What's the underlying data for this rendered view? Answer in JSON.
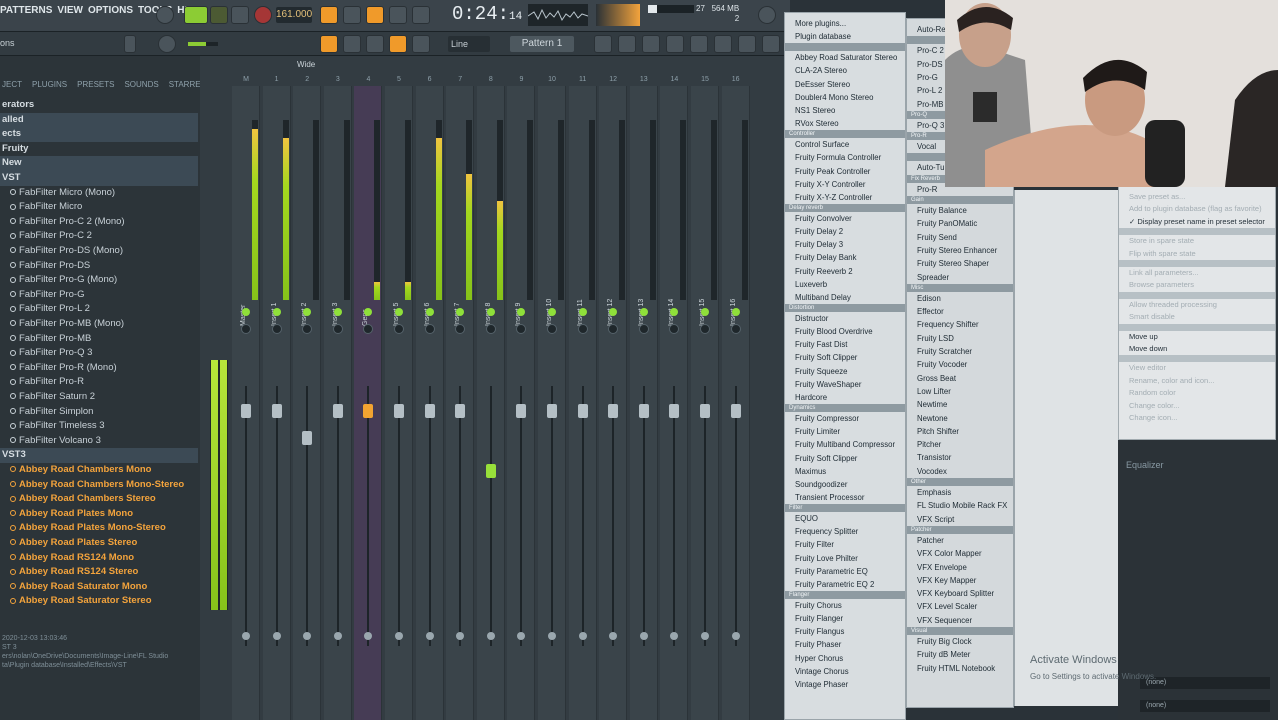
{
  "menu": [
    "PATTERNS",
    "VIEW",
    "OPTIONS",
    "TOOLS",
    "HELP"
  ],
  "transport": {
    "tempo": "161.000",
    "time_main": "0:24:",
    "time_sub": "14",
    "cpu_a": "27",
    "mem": "564 MB",
    "poly": "2"
  },
  "toolbar": {
    "snap": "Line",
    "pattern": "Pattern 1"
  },
  "browser": {
    "header_left": "ons",
    "tabs": [
      "JECT",
      "PLUGINS",
      "PRESETS",
      "SOUNDS",
      "STARRED"
    ],
    "items": [
      {
        "label": "erators",
        "kind": "folder"
      },
      {
        "label": "alled",
        "kind": "folder",
        "sel": true
      },
      {
        "label": "ects",
        "kind": "folder",
        "sel": true
      },
      {
        "label": "Fruity",
        "kind": "folder"
      },
      {
        "label": "New",
        "kind": "folder",
        "sel": true
      },
      {
        "label": "VST",
        "kind": "folder",
        "sel": true
      },
      {
        "label": "FabFilter Micro (Mono)",
        "kind": "plugin"
      },
      {
        "label": "FabFilter Micro",
        "kind": "plugin"
      },
      {
        "label": "FabFilter Pro-C 2 (Mono)",
        "kind": "plugin"
      },
      {
        "label": "FabFilter Pro-C 2",
        "kind": "plugin"
      },
      {
        "label": "FabFilter Pro-DS (Mono)",
        "kind": "plugin"
      },
      {
        "label": "FabFilter Pro-DS",
        "kind": "plugin"
      },
      {
        "label": "FabFilter Pro-G (Mono)",
        "kind": "plugin"
      },
      {
        "label": "FabFilter Pro-G",
        "kind": "plugin"
      },
      {
        "label": "FabFilter Pro-L 2",
        "kind": "plugin"
      },
      {
        "label": "FabFilter Pro-MB (Mono)",
        "kind": "plugin"
      },
      {
        "label": "FabFilter Pro-MB",
        "kind": "plugin"
      },
      {
        "label": "FabFilter Pro-Q 3",
        "kind": "plugin"
      },
      {
        "label": "FabFilter Pro-R (Mono)",
        "kind": "plugin"
      },
      {
        "label": "FabFilter Pro-R",
        "kind": "plugin"
      },
      {
        "label": "FabFilter Saturn 2",
        "kind": "plugin"
      },
      {
        "label": "FabFilter Simplon",
        "kind": "plugin"
      },
      {
        "label": "FabFilter Timeless 3",
        "kind": "plugin"
      },
      {
        "label": "FabFilter Volcano 3",
        "kind": "plugin"
      },
      {
        "label": "VST3",
        "kind": "folder",
        "sel": true
      },
      {
        "label": "Abbey Road Chambers Mono",
        "kind": "plugin",
        "orange": true
      },
      {
        "label": "Abbey Road Chambers Mono-Stereo",
        "kind": "plugin",
        "orange": true
      },
      {
        "label": "Abbey Road Chambers Stereo",
        "kind": "plugin",
        "orange": true
      },
      {
        "label": "Abbey Road Plates Mono",
        "kind": "plugin",
        "orange": true
      },
      {
        "label": "Abbey Road Plates Mono-Stereo",
        "kind": "plugin",
        "orange": true
      },
      {
        "label": "Abbey Road Plates Stereo",
        "kind": "plugin",
        "orange": true
      },
      {
        "label": "Abbey Road RS124 Mono",
        "kind": "plugin",
        "orange": true
      },
      {
        "label": "Abbey Road RS124 Stereo",
        "kind": "plugin",
        "orange": true
      },
      {
        "label": "Abbey Road Saturator Mono",
        "kind": "plugin",
        "orange": true
      },
      {
        "label": "Abbey Road Saturator Stereo",
        "kind": "plugin",
        "orange": true
      }
    ],
    "info": [
      "2020-12-03 13:03:46",
      "ST 3",
      "ers\\nolan\\OneDrive\\Documents\\Image-Line\\FL Studio",
      "ta\\Plugin database\\Installed\\Effects\\VST"
    ]
  },
  "mixer": {
    "view_mode": "Wide",
    "strips": [
      {
        "num": "M",
        "label": "Master",
        "meter": 0.95,
        "knob": true
      },
      {
        "num": "1",
        "label": "Insert 1",
        "meter": 0.9,
        "knob": true
      },
      {
        "num": "2",
        "label": "Insert 2",
        "meter": 0,
        "knob": true
      },
      {
        "num": "3",
        "label": "Insert 3",
        "meter": 0,
        "knob": true
      },
      {
        "num": "4",
        "label": "Gens",
        "meter": 0.1,
        "knob": true,
        "sel": true
      },
      {
        "num": "5",
        "label": "Insert 5",
        "meter": 0.1,
        "knob": true
      },
      {
        "num": "6",
        "label": "Insert 6",
        "meter": 0.9,
        "knob": true
      },
      {
        "num": "7",
        "label": "Insert 7",
        "meter": 0.7,
        "knob": true
      },
      {
        "num": "8",
        "label": "Insert 8",
        "meter": 0.55,
        "knob": true
      },
      {
        "num": "9",
        "label": "Insert 9",
        "meter": 0,
        "knob": true
      },
      {
        "num": "10",
        "label": "Insert 10",
        "meter": 0,
        "knob": true
      },
      {
        "num": "11",
        "label": "Insert 11",
        "meter": 0,
        "knob": true
      },
      {
        "num": "12",
        "label": "Insert 12",
        "meter": 0,
        "knob": true
      },
      {
        "num": "13",
        "label": "Insert 13",
        "meter": 0,
        "knob": true
      },
      {
        "num": "14",
        "label": "Insert 14",
        "meter": 0,
        "knob": true
      },
      {
        "num": "15",
        "label": "Insert 15",
        "meter": 0,
        "knob": true
      },
      {
        "num": "16",
        "label": "Insert 16",
        "meter": 0,
        "knob": true
      }
    ]
  },
  "menu1": [
    {
      "t": "More plugins..."
    },
    {
      "t": "Plugin database"
    },
    {
      "h": true
    },
    {
      "t": "Abbey Road Saturator Stereo"
    },
    {
      "t": "CLA-2A Stereo"
    },
    {
      "t": "DeEsser Stereo"
    },
    {
      "t": "Doubler4 Mono Stereo"
    },
    {
      "t": "NS1 Stereo"
    },
    {
      "t": "RVox Stereo"
    },
    {
      "h": true,
      "t": "Controller"
    },
    {
      "t": "Control Surface"
    },
    {
      "t": "Fruity Formula Controller"
    },
    {
      "t": "Fruity Peak Controller"
    },
    {
      "t": "Fruity X-Y Controller"
    },
    {
      "t": "Fruity X-Y-Z Controller"
    },
    {
      "h": true,
      "t": "Delay reverb"
    },
    {
      "t": "Fruity Convolver"
    },
    {
      "t": "Fruity Delay 2"
    },
    {
      "t": "Fruity Delay 3"
    },
    {
      "t": "Fruity Delay Bank"
    },
    {
      "t": "Fruity Reeverb 2"
    },
    {
      "t": "Luxeverb"
    },
    {
      "t": "Multiband Delay"
    },
    {
      "h": true,
      "t": "Distortion"
    },
    {
      "t": "Distructor"
    },
    {
      "t": "Fruity Blood Overdrive"
    },
    {
      "t": "Fruity Fast Dist"
    },
    {
      "t": "Fruity Soft Clipper"
    },
    {
      "t": "Fruity Squeeze"
    },
    {
      "t": "Fruity WaveShaper"
    },
    {
      "t": "Hardcore"
    },
    {
      "h": true,
      "t": "Dynamics"
    },
    {
      "t": "Fruity Compressor"
    },
    {
      "t": "Fruity Limiter"
    },
    {
      "t": "Fruity Multiband Compressor"
    },
    {
      "t": "Fruity Soft Clipper"
    },
    {
      "t": "Maximus"
    },
    {
      "t": "Soundgoodizer"
    },
    {
      "t": "Transient Processor"
    },
    {
      "h": true,
      "t": "Filter"
    },
    {
      "t": "EQUO"
    },
    {
      "t": "Frequency Splitter"
    },
    {
      "t": "Fruity Filter"
    },
    {
      "t": "Fruity Love Philter"
    },
    {
      "t": "Fruity Parametric EQ"
    },
    {
      "t": "Fruity Parametric EQ 2"
    },
    {
      "h": true,
      "t": "Flanger"
    },
    {
      "t": "Fruity Chorus"
    },
    {
      "t": "Fruity Flanger"
    },
    {
      "t": "Fruity Flangus"
    },
    {
      "t": "Fruity Phaser"
    },
    {
      "t": "Hyper Chorus"
    },
    {
      "t": "Vintage Chorus"
    },
    {
      "t": "Vintage Phaser"
    }
  ],
  "menu2": [
    {
      "t": "Auto-Re"
    },
    {
      "h": true
    },
    {
      "t": "Pro-C 2"
    },
    {
      "t": "Pro-DS"
    },
    {
      "t": "Pro-G"
    },
    {
      "t": "Pro-L 2"
    },
    {
      "t": "Pro-MB"
    },
    {
      "h": true,
      "t": "Pro-Q"
    },
    {
      "t": "Pro-Q 3"
    },
    {
      "h": true,
      "t": "Pro-R"
    },
    {
      "t": "Vocal"
    },
    {
      "h": true
    },
    {
      "t": "Auto-Tu"
    },
    {
      "h": true,
      "t": "Fix Reverb"
    },
    {
      "t": "Pro-R"
    },
    {
      "h": true,
      "t": "Gain"
    },
    {
      "t": "Fruity Balance"
    },
    {
      "t": "Fruity PanOMatic"
    },
    {
      "t": "Fruity Send"
    },
    {
      "t": "Fruity Stereo Enhancer"
    },
    {
      "t": "Fruity Stereo Shaper"
    },
    {
      "t": "Spreader"
    },
    {
      "h": true,
      "t": "Misc"
    },
    {
      "t": "Edison"
    },
    {
      "t": "Effector"
    },
    {
      "t": "Frequency Shifter"
    },
    {
      "t": "Fruity LSD"
    },
    {
      "t": "Fruity Scratcher"
    },
    {
      "t": "Fruity Vocoder"
    },
    {
      "t": "Gross Beat"
    },
    {
      "t": "Low Lifter"
    },
    {
      "t": "Newtime"
    },
    {
      "t": "Newtone"
    },
    {
      "t": "Pitch Shifter"
    },
    {
      "t": "Pitcher"
    },
    {
      "t": "Transistor"
    },
    {
      "t": "Vocodex"
    },
    {
      "h": true,
      "t": "Other"
    },
    {
      "t": "Emphasis"
    },
    {
      "t": "FL Studio Mobile Rack FX"
    },
    {
      "t": "VFX Script"
    },
    {
      "h": true,
      "t": "Patcher"
    },
    {
      "t": "Patcher"
    },
    {
      "t": "VFX Color Mapper"
    },
    {
      "t": "VFX Envelope"
    },
    {
      "t": "VFX Key Mapper"
    },
    {
      "t": "VFX Keyboard Splitter"
    },
    {
      "t": "VFX Level Scaler"
    },
    {
      "t": "VFX Sequencer"
    },
    {
      "h": true,
      "t": "Visual"
    },
    {
      "t": "Fruity Big Clock"
    },
    {
      "t": "Fruity dB Meter"
    },
    {
      "t": "Fruity HTML Notebook"
    }
  ],
  "menu4": [
    {
      "t": "Save preset as...",
      "dis": true
    },
    {
      "t": "Add to plugin database (flag as favorite)",
      "dis": true
    },
    {
      "t": "✓ Display preset name in preset selector"
    },
    {
      "h": true
    },
    {
      "t": "Store in spare state",
      "dis": true
    },
    {
      "t": "Flip with spare state",
      "dis": true
    },
    {
      "h": true
    },
    {
      "t": "Link all parameters...",
      "dis": true
    },
    {
      "t": "Browse parameters",
      "dis": true
    },
    {
      "h": true
    },
    {
      "t": "Allow threaded processing",
      "dis": true
    },
    {
      "t": "Smart disable",
      "dis": true
    },
    {
      "h": true
    },
    {
      "t": "Move up"
    },
    {
      "t": "Move down"
    },
    {
      "h": true
    },
    {
      "t": "View editor",
      "dis": true
    },
    {
      "t": "Rename, color and icon...",
      "dis": true
    },
    {
      "t": "Random color",
      "dis": true
    },
    {
      "t": "Change color...",
      "dis": true
    },
    {
      "t": "Change icon...",
      "dis": true
    }
  ],
  "right_panel": {
    "eq_label": "Equalizer",
    "slot_none": "(none)"
  },
  "watermark": {
    "title": "Activate Windows",
    "sub": "Go to Settings to activate Windows."
  }
}
